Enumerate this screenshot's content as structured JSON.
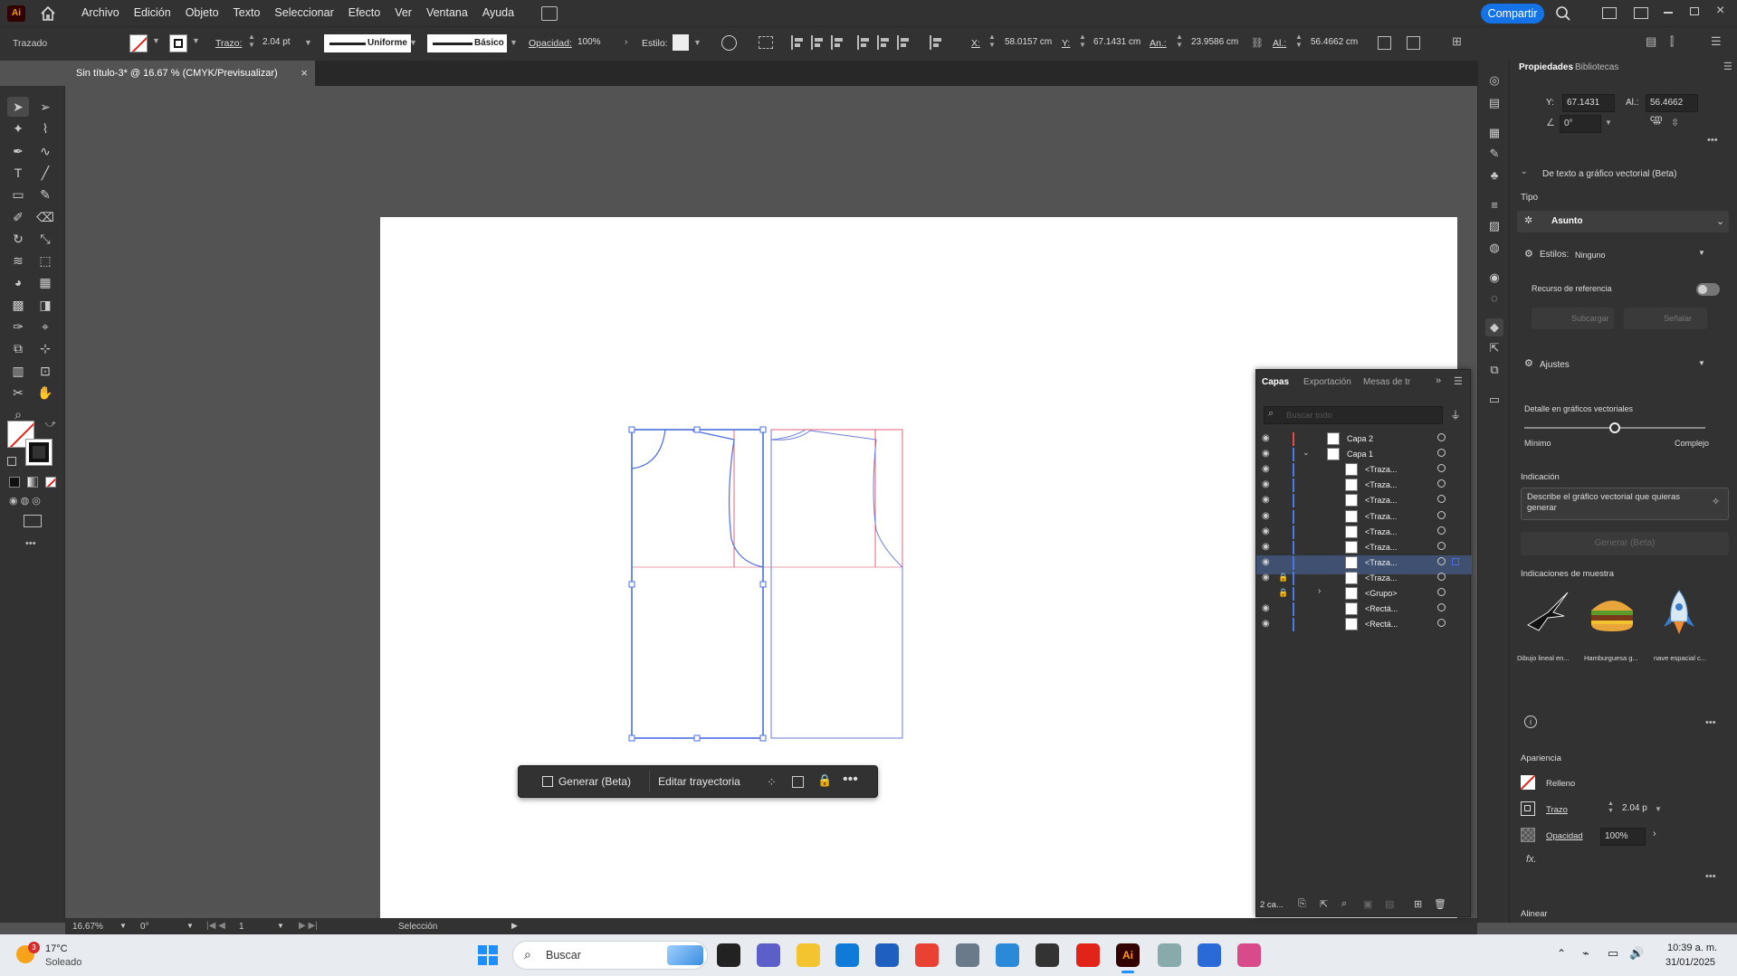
{
  "menubar": {
    "app_logo": "Ai",
    "items": [
      "Archivo",
      "Edición",
      "Objeto",
      "Texto",
      "Seleccionar",
      "Efecto",
      "Ver",
      "Ventana",
      "Ayuda"
    ],
    "share_label": "Compartir"
  },
  "control": {
    "mode_label": "Trazado",
    "stroke_label": "Trazo:",
    "stroke_value": "2.04 pt",
    "profile_label": "Uniforme",
    "brush_label": "Básico",
    "opacity_label": "Opacidad:",
    "opacity_value": "100%",
    "style_label": "Estilo:",
    "x_label": "X:",
    "x_value": "58.0157 cm",
    "y_label": "Y:",
    "y_value": "67.1431 cm",
    "w_label": "An.:",
    "w_value": "23.9586 cm",
    "h_label": "Al.:",
    "h_value": "56.4662 cm"
  },
  "document": {
    "tab_title": "Sin título-3* @ 16.67 % (CMYK/Previsualizar)"
  },
  "status": {
    "zoom": "16.67%",
    "rotation": "0°",
    "artboard_num": "1",
    "tool_name": "Selección"
  },
  "context_bar": {
    "generate_label": "Generar (Beta)",
    "edit_path_label": "Editar trayectoria"
  },
  "properties": {
    "tabs": [
      "Propiedades",
      "Bibliotecas"
    ],
    "y_label": "Y:",
    "y_value": "67.1431 cm",
    "h_label": "Al.:",
    "h_value": "56.4662 cm",
    "angle_value": "0°",
    "section_title": "De texto a gráfico vectorial (Beta)",
    "type_label": "Tipo",
    "type_value": "Asunto",
    "styles_label": "Estilos:",
    "styles_value": "Ninguno",
    "ref_label": "Recurso de referencia",
    "btn_load": "Subcargar",
    "btn_pick": "Señalar",
    "adjust_label": "Ajustes",
    "detail_label": "Detalle en gráficos vectoriales",
    "min_label": "Mínimo",
    "max_label": "Complejo",
    "detail_level": 0.5,
    "prompt_label": "Indicación",
    "prompt_placeholder": "Describe el gráfico vectorial que quieras generar",
    "gen_button": "Generar (Beta)",
    "samples_label": "Indicaciones de muestra",
    "samples": [
      "Dibujo lineal en...",
      "Hamburguesa g...",
      "nave espacial c..."
    ],
    "appearance_label": "Apariencia",
    "fill_label": "Relleno",
    "stroke_label": "Trazo",
    "stroke_value": "2.04 p",
    "opacity_label": "Opacidad",
    "opacity_value": "100%",
    "fx_label": "fx.",
    "align_label": "Alinear"
  },
  "layers": {
    "tabs": [
      "Capas",
      "Exportación",
      "Mesas de tr"
    ],
    "search_placeholder": "Buscar todo",
    "footer_count": "2 ca...",
    "rows": [
      {
        "name": "Capa 2",
        "indent": 0,
        "locked": false,
        "visible": true,
        "color": "#e84a4a"
      },
      {
        "name": "Capa 1",
        "indent": 0,
        "locked": false,
        "visible": true,
        "color": "#4a7ae8",
        "expanded": true
      },
      {
        "name": "<Traza...",
        "indent": 1,
        "locked": false,
        "visible": true,
        "color": "#4a7ae8"
      },
      {
        "name": "<Traza...",
        "indent": 1,
        "locked": false,
        "visible": true,
        "color": "#4a7ae8"
      },
      {
        "name": "<Traza...",
        "indent": 1,
        "locked": false,
        "visible": true,
        "color": "#4a7ae8"
      },
      {
        "name": "<Traza...",
        "indent": 1,
        "locked": false,
        "visible": true,
        "color": "#4a7ae8"
      },
      {
        "name": "<Traza...",
        "indent": 1,
        "locked": false,
        "visible": true,
        "color": "#4a7ae8"
      },
      {
        "name": "<Traza...",
        "indent": 1,
        "locked": false,
        "visible": true,
        "color": "#4a7ae8"
      },
      {
        "name": "<Traza...",
        "indent": 1,
        "locked": false,
        "visible": true,
        "color": "#4a7ae8",
        "selected": true
      },
      {
        "name": "<Traza...",
        "indent": 1,
        "locked": true,
        "visible": true,
        "color": "#4a7ae8"
      },
      {
        "name": "<Grupo>",
        "indent": 1,
        "locked": true,
        "visible": false,
        "color": "#4a7ae8",
        "group": true
      },
      {
        "name": "<Rectá...",
        "indent": 1,
        "locked": false,
        "visible": true,
        "color": "#4a7ae8"
      },
      {
        "name": "<Rectá...",
        "indent": 1,
        "locked": false,
        "visible": true,
        "color": "#4a7ae8"
      }
    ]
  },
  "taskbar": {
    "temp": "17°C",
    "weather": "Soleado",
    "badge": "3",
    "search_label": "Buscar",
    "time": "10:39 a. m.",
    "date": "31/01/2025"
  },
  "colors": {
    "accent": "#1473e6",
    "selection": "#4a6ee0",
    "guide": "#e8607a"
  }
}
